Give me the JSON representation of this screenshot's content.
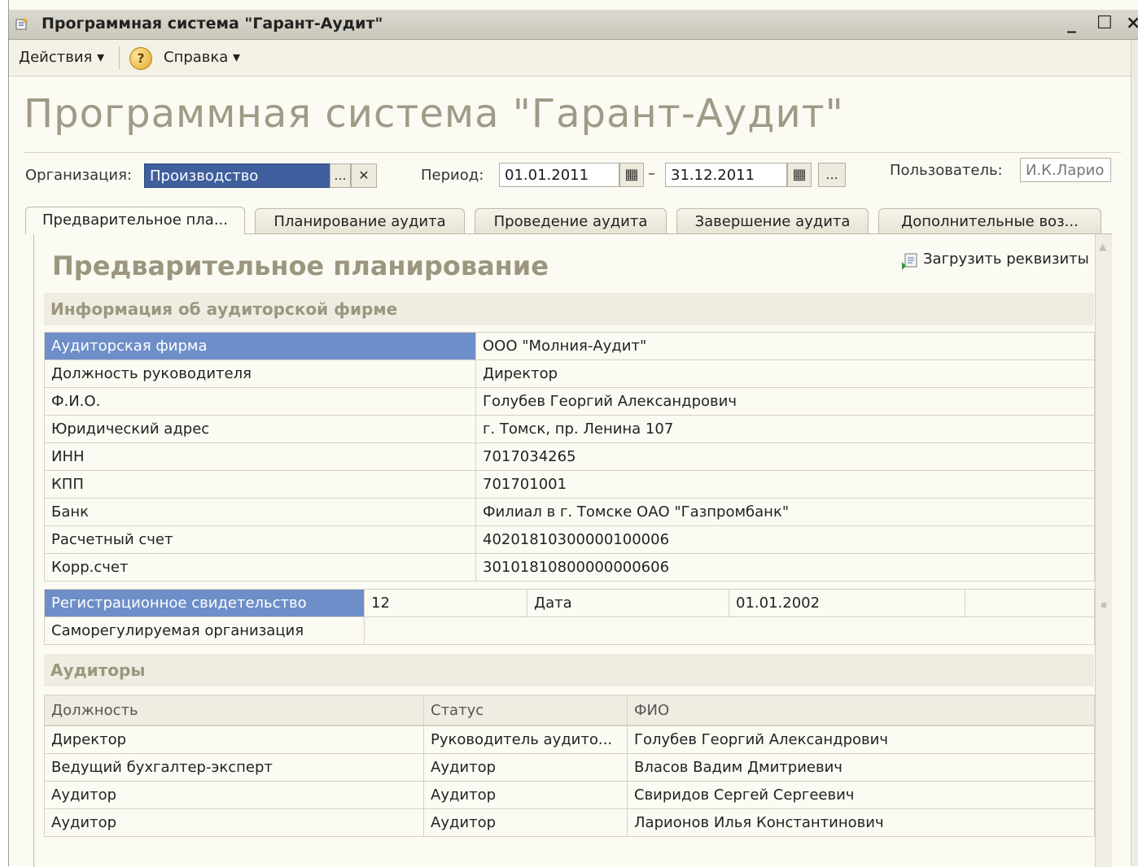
{
  "window": {
    "title": "Программная система \"Гарант-Аудит\"",
    "controls": {
      "minimize": "_",
      "maximize": "☐",
      "close": "×"
    }
  },
  "menu": {
    "actions": "Действия ▾",
    "help": "Справка ▾",
    "help_icon_glyph": "?"
  },
  "page_title": "Программная система \"Гарант-Аудит\"",
  "filters": {
    "organization_label": "Организация:",
    "organization_value": "Производство",
    "select_button": "...",
    "clear_button": "✕",
    "period_label": "Период:",
    "period_from": "01.01.2011",
    "period_dash": "–",
    "period_to": "31.12.2011",
    "calendar_glyph": "▦",
    "period_more": "...",
    "user_label": "Пользователь:",
    "user_value": "И.К.Ларио"
  },
  "tabs": [
    "Предварительное пла...",
    "Планирование аудита",
    "Проведение аудита",
    "Завершение аудита",
    "Дополнительные воз..."
  ],
  "section": {
    "title": "Предварительное планирование",
    "load_button": "Загрузить реквизиты"
  },
  "firm": {
    "header": "Информация об аудиторской фирме",
    "rows": [
      [
        "Аудиторская фирма",
        "ООО \"Молния-Аудит\""
      ],
      [
        "Должность руководителя",
        "Директор"
      ],
      [
        "Ф.И.О.",
        "Голубев Георгий Александрович"
      ],
      [
        "Юридический адрес",
        "г. Томск, пр. Ленина 107"
      ],
      [
        "ИНН",
        "7017034265"
      ],
      [
        "КПП",
        "701701001"
      ],
      [
        "Банк",
        "Филиал в г. Томске ОАО \"Газпромбанк\""
      ],
      [
        "Расчетный счет",
        "40201810300000100006"
      ],
      [
        "Корр.счет",
        "30101810800000000606"
      ]
    ],
    "registration": {
      "label": "Регистрационное свидетельство",
      "number": "12",
      "date_label": "Дата",
      "date": "01.01.2002"
    },
    "sro_label": "Саморегулируемая организация"
  },
  "auditors": {
    "header": "Аудиторы",
    "columns": [
      "Должность",
      "Статус",
      "ФИО"
    ],
    "rows": [
      [
        "Директор",
        "Руководитель аудито...",
        "Голубев Георгий Александрович"
      ],
      [
        "Ведущий бухгалтер-эксперт",
        "Аудитор",
        "Власов Вадим Дмитриевич"
      ],
      [
        "Аудитор",
        "Аудитор",
        "Свиридов Сергей Сергеевич"
      ],
      [
        "Аудитор",
        "Аудитор",
        "Ларионов Илья Константинович"
      ]
    ]
  },
  "colors": {
    "selection": "#6d8ec8",
    "title_gray": "#a09a86",
    "background": "#fbfbf4"
  }
}
